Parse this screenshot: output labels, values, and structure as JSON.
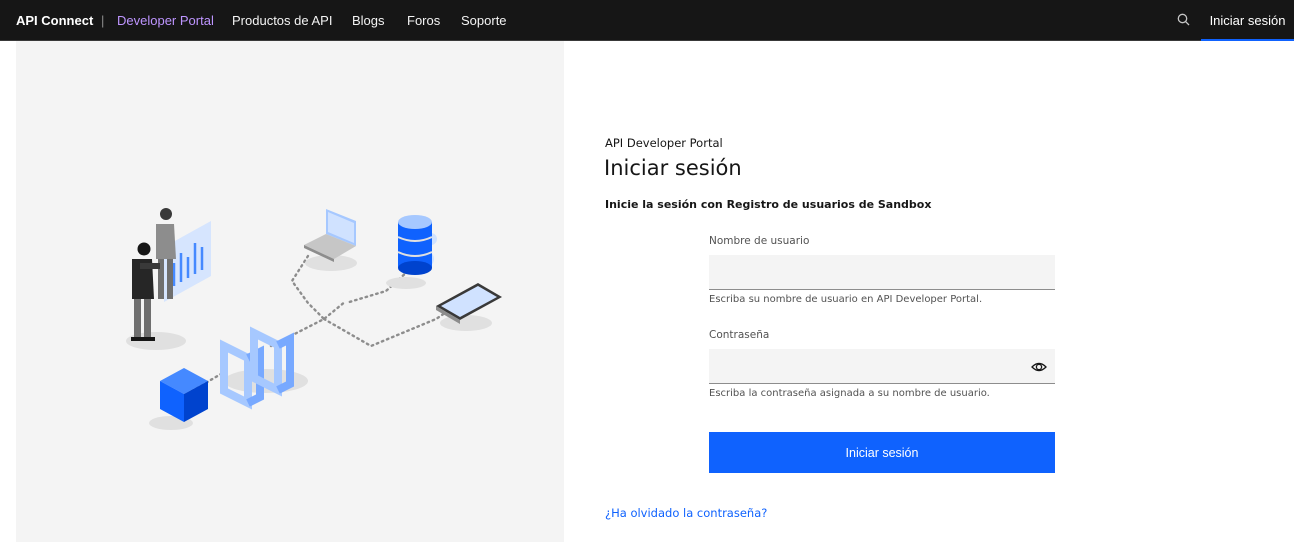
{
  "header": {
    "brand": "API Connect",
    "separator": "|",
    "nav": [
      {
        "label": "Developer Portal",
        "active": true
      },
      {
        "label": "Productos de API",
        "active": false
      },
      {
        "label": "Blogs",
        "active": false
      },
      {
        "label": "Foros",
        "active": false
      },
      {
        "label": "Soporte",
        "active": false
      }
    ],
    "search_icon": "search-icon",
    "signin_label": "Iniciar sesión"
  },
  "login": {
    "eyebrow": "API Developer Portal",
    "title": "Iniciar sesión",
    "subtitle": "Inicie la sesión con Registro de usuarios de Sandbox",
    "username": {
      "label": "Nombre de usuario",
      "value": "",
      "helper": "Escriba su nombre de usuario en API Developer Portal."
    },
    "password": {
      "label": "Contraseña",
      "value": "",
      "helper": "Escriba la contraseña asignada a su nombre de usuario.",
      "toggle_icon": "eye-icon"
    },
    "submit_label": "Iniciar sesión",
    "forgot_label": "¿Ha olvidado la contraseña?"
  },
  "colors": {
    "topbar": "#161616",
    "active_nav": "#be95ff",
    "primary": "#0f62fe",
    "panel_bg": "#f4f4f4"
  }
}
